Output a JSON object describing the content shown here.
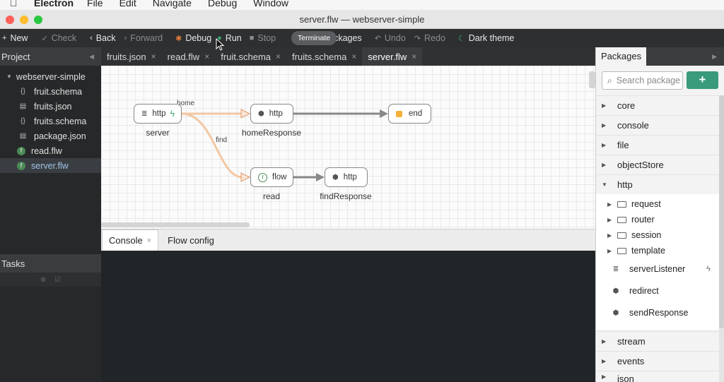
{
  "menubar": {
    "app_name": "Electron",
    "items": [
      "File",
      "Edit",
      "Navigate",
      "Debug",
      "Window"
    ]
  },
  "window": {
    "title": "server.flw — webserver-simple",
    "traffic_colors": [
      "#fe5f57",
      "#febc2e",
      "#28c840"
    ]
  },
  "toolbar": {
    "new": "New",
    "check": "Check",
    "back": "Back",
    "forward": "Forward",
    "debug": "Debug",
    "run": "Run",
    "stop": "Stop",
    "packages_partial": "ackages",
    "undo": "Undo",
    "redo": "Redo",
    "dark_theme": "Dark theme",
    "tooltip": "Terminate"
  },
  "project": {
    "header": "Project",
    "root": "webserver-simple",
    "files": [
      {
        "name": "fruit.schema",
        "icon": "braces-icon"
      },
      {
        "name": "fruits.json",
        "icon": "file-icon"
      },
      {
        "name": "fruits.schema",
        "icon": "braces-icon"
      },
      {
        "name": "package.json",
        "icon": "file-icon"
      },
      {
        "name": "read.flw",
        "icon": "flow-icon"
      },
      {
        "name": "server.flw",
        "icon": "flow-icon"
      }
    ],
    "selected": "server.flw"
  },
  "tasks": {
    "header": "Tasks"
  },
  "editor_tabs": [
    {
      "label": "fruits.json",
      "active": false
    },
    {
      "label": "read.flw",
      "active": false
    },
    {
      "label": "fruit.schema",
      "active": false
    },
    {
      "label": "fruits.schema",
      "active": false
    },
    {
      "label": "server.flw",
      "active": true
    }
  ],
  "flow": {
    "nodes": {
      "server": {
        "type": "http",
        "label": "server"
      },
      "homeResponse": {
        "type": "http",
        "label": "homeResponse"
      },
      "end": {
        "type": "end",
        "label": ""
      },
      "read": {
        "type": "flow",
        "label": "read"
      },
      "findResponse": {
        "type": "http",
        "label": "findResponse"
      }
    },
    "edges": {
      "home": "home",
      "find": "find"
    },
    "colors": {
      "route_edge": "#f2c8a4",
      "edge": "#888888",
      "end_icon": "#f6b13a",
      "trigger_icon": "#3aa76d"
    }
  },
  "console_tabs": {
    "console": "Console",
    "flow_config": "Flow config"
  },
  "packages": {
    "header": "Packages",
    "search_placeholder": "Search packages",
    "add_label": "+",
    "items_before": [
      "core",
      "console",
      "file",
      "objectStore"
    ],
    "expanded": "http",
    "http_folders": [
      "request",
      "router",
      "session",
      "template"
    ],
    "http_leaves": [
      "serverListener",
      "redirect",
      "sendResponse"
    ],
    "items_after": [
      "stream",
      "events",
      "json"
    ],
    "accent": "#3a9a7c"
  }
}
